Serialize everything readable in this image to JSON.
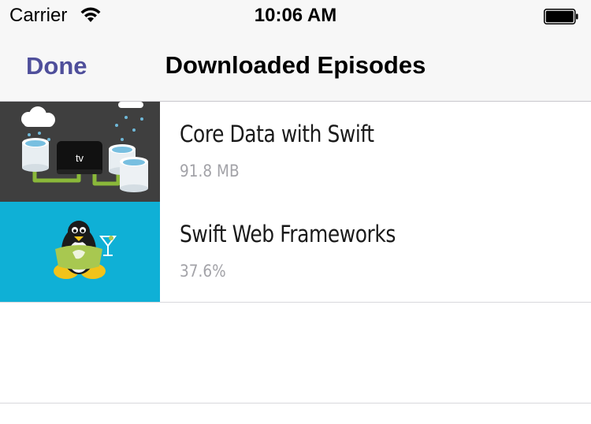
{
  "status_bar": {
    "carrier": "Carrier",
    "time": "10:06 AM",
    "wifi_icon": "wifi-icon",
    "battery_icon": "battery-icon"
  },
  "nav": {
    "done_label": "Done",
    "title": "Downloaded Episodes",
    "accent_color": "#4f4f9b"
  },
  "episodes": [
    {
      "title": "Core Data with Swift",
      "detail": "91.8 MB",
      "thumbnail_label": "tv",
      "thumbnail_background": "#3a3a3a"
    },
    {
      "title": "Swift Web Frameworks",
      "detail": "37.6%",
      "thumbnail_background": "#0fb0d6"
    }
  ]
}
